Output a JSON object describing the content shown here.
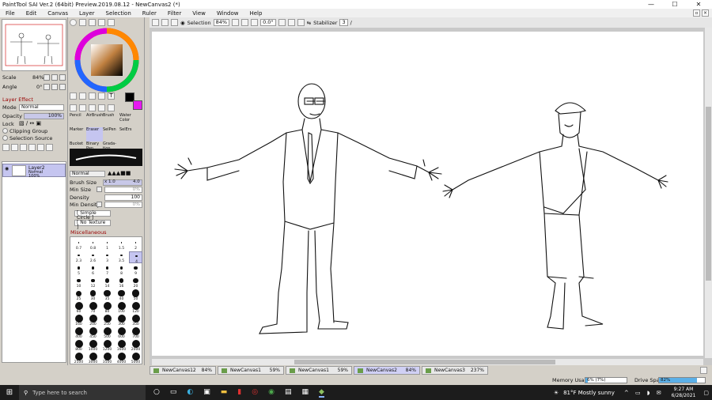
{
  "window": {
    "title": "PaintTool SAI Ver.2 (64bit) Preview.2019.08.12 - NewCanvas2 (*)",
    "minimize": "—",
    "maximize": "☐",
    "close": "✕"
  },
  "menu": {
    "items": [
      "File",
      "Edit",
      "Canvas",
      "Layer",
      "Selection",
      "Ruler",
      "Filter",
      "View",
      "Window",
      "Help"
    ]
  },
  "toolbar": {
    "selection_label": "Selection",
    "zoom": "84%",
    "angle": "0.0°",
    "stabilizer_label": "Stabilizer",
    "stabilizer_value": "3"
  },
  "navigator": {
    "scale_label": "Scale",
    "scale_value": "84%",
    "angle_label": "Angle",
    "angle_value": "0°"
  },
  "layer_effect": {
    "header": "Layer Effect",
    "mode_label": "Mode",
    "mode_value": "Normal",
    "opacity_label": "Opacity",
    "opacity_value": "100%",
    "lock_label": "Lock",
    "clipping_label": "Clipping Group",
    "selection_source_label": "Selection Source"
  },
  "layers": [
    {
      "name": "Layer2",
      "mode": "Normal",
      "opacity": "100%"
    }
  ],
  "tools": {
    "rows": [
      [
        "Pencil",
        "AirBrush",
        "Brush",
        "Water Color"
      ],
      [
        "Marker",
        "Eraser",
        "SelPen",
        "SelErs"
      ],
      [
        "Bucket",
        "Binary Pen",
        "Grada-tion",
        ""
      ]
    ]
  },
  "brush": {
    "mode": "Normal",
    "size_label": "Brush Size",
    "size_mult": "x 1.0",
    "size_value": "4.0",
    "min_size_label": "Min Size",
    "min_size_value": "0%",
    "density_label": "Density",
    "density_value": "100",
    "min_density_label": "Min Density",
    "min_density_value": "0%",
    "shape": "[ Simple Circle ]",
    "texture": "[ No Texture ]",
    "misc_label": "Miscellaneous"
  },
  "brush_sizes": [
    "0.7",
    "0.8",
    "1",
    "1.5",
    "2",
    "2.3",
    "2.6",
    "3",
    "3.5",
    "4",
    "5",
    "6",
    "7",
    "8",
    "9",
    "10",
    "12",
    "14",
    "16",
    "20",
    "25",
    "30",
    "35",
    "40",
    "50",
    "60",
    "70",
    "80",
    "100",
    "120",
    "160",
    "200",
    "250",
    "300",
    "350",
    "400",
    "450",
    "500",
    "600",
    "700",
    "800",
    "1000",
    "1200",
    "1600",
    "2000",
    "2500",
    "3000",
    "3500",
    "4000",
    "5000"
  ],
  "documents": [
    {
      "name": "NewCanvas12",
      "zoom": "84%"
    },
    {
      "name": "NewCanvas1",
      "zoom": "59%"
    },
    {
      "name": "NewCanvas1",
      "zoom": "59%"
    },
    {
      "name": "NewCanvas2",
      "zoom": "84%",
      "active": true
    },
    {
      "name": "NewCanvas3",
      "zoom": "237%"
    }
  ],
  "status": {
    "memory_label": "Memory Usage",
    "memory_value": "6% (7%)",
    "memory_fraction": 0.06,
    "drive_label": "Drive Space",
    "drive_value": "82%",
    "drive_fraction": 0.82
  },
  "taskbar": {
    "search_placeholder": "Type here to search",
    "weather": "81°F  Mostly sunny",
    "time": "9:27 AM",
    "date": "6/28/2021"
  },
  "colors": {
    "accent": "#c5c5f0",
    "swatch_primary": "#000000",
    "swatch_secondary": "#e619f0",
    "taskbar": "#1c1c1c"
  }
}
